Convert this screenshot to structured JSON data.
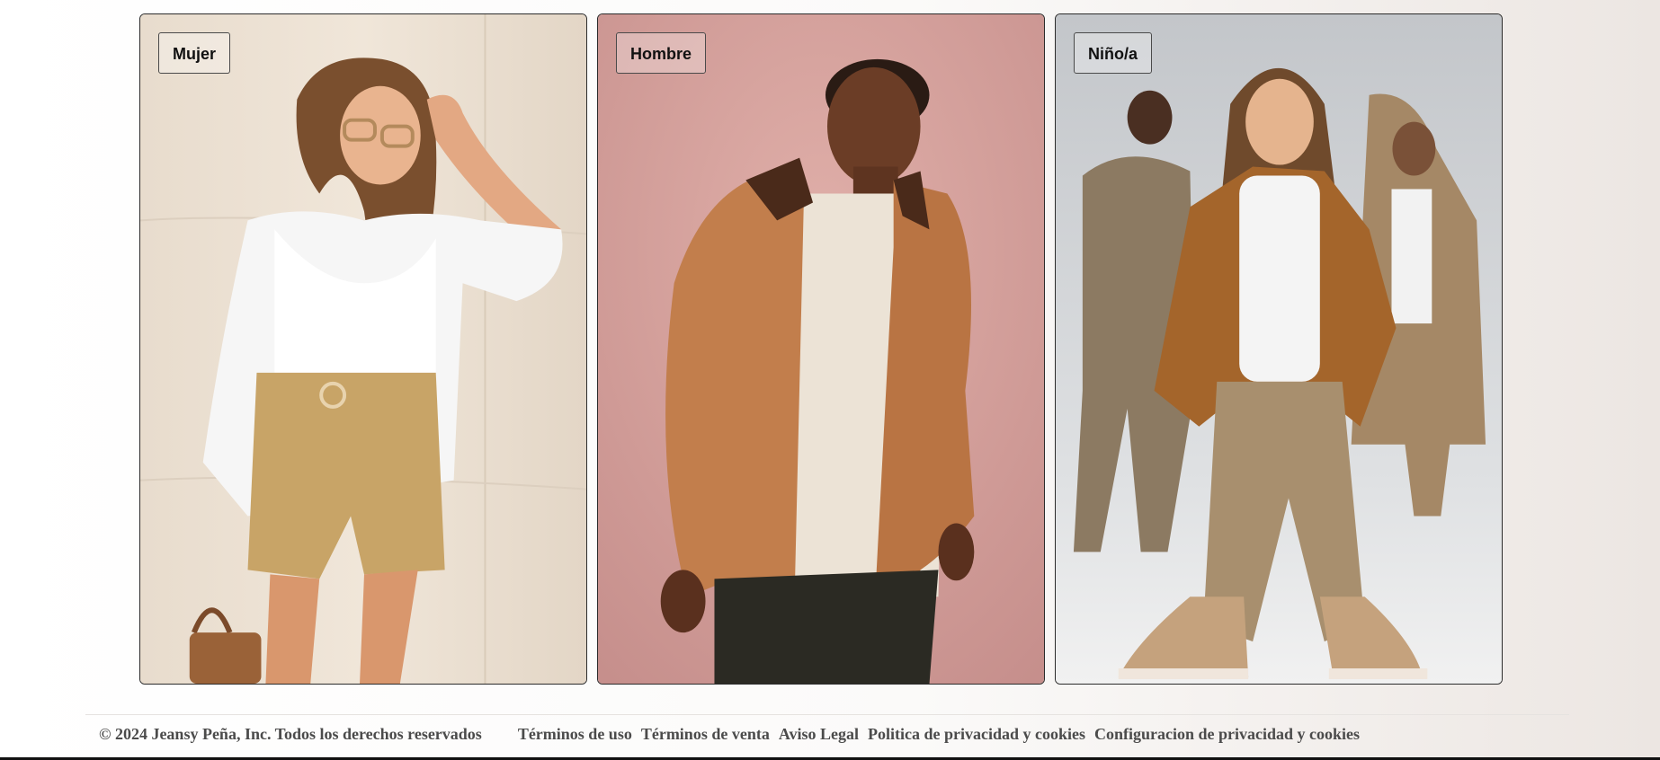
{
  "categories": [
    {
      "label": "Mujer",
      "photo_icon": "woman-fashion-photo",
      "bg": "#e9ddd0"
    },
    {
      "label": "Hombre",
      "photo_icon": "man-fashion-photo",
      "bg": "#d6a29e"
    },
    {
      "label": "Niño/a",
      "photo_icon": "kids-fashion-photo",
      "bg": "#c9cbce"
    }
  ],
  "footer": {
    "copyright": "© 2024 Jeansy Peña, Inc. Todos los derechos reservados",
    "links": [
      "Términos de uso",
      "Términos de venta",
      "Aviso Legal",
      "Politica de privacidad y cookies",
      "Configuracion de privacidad y cookies"
    ]
  },
  "colors": {
    "card_border": "#2b2b2b",
    "footer_text": "#4b4b4b"
  }
}
